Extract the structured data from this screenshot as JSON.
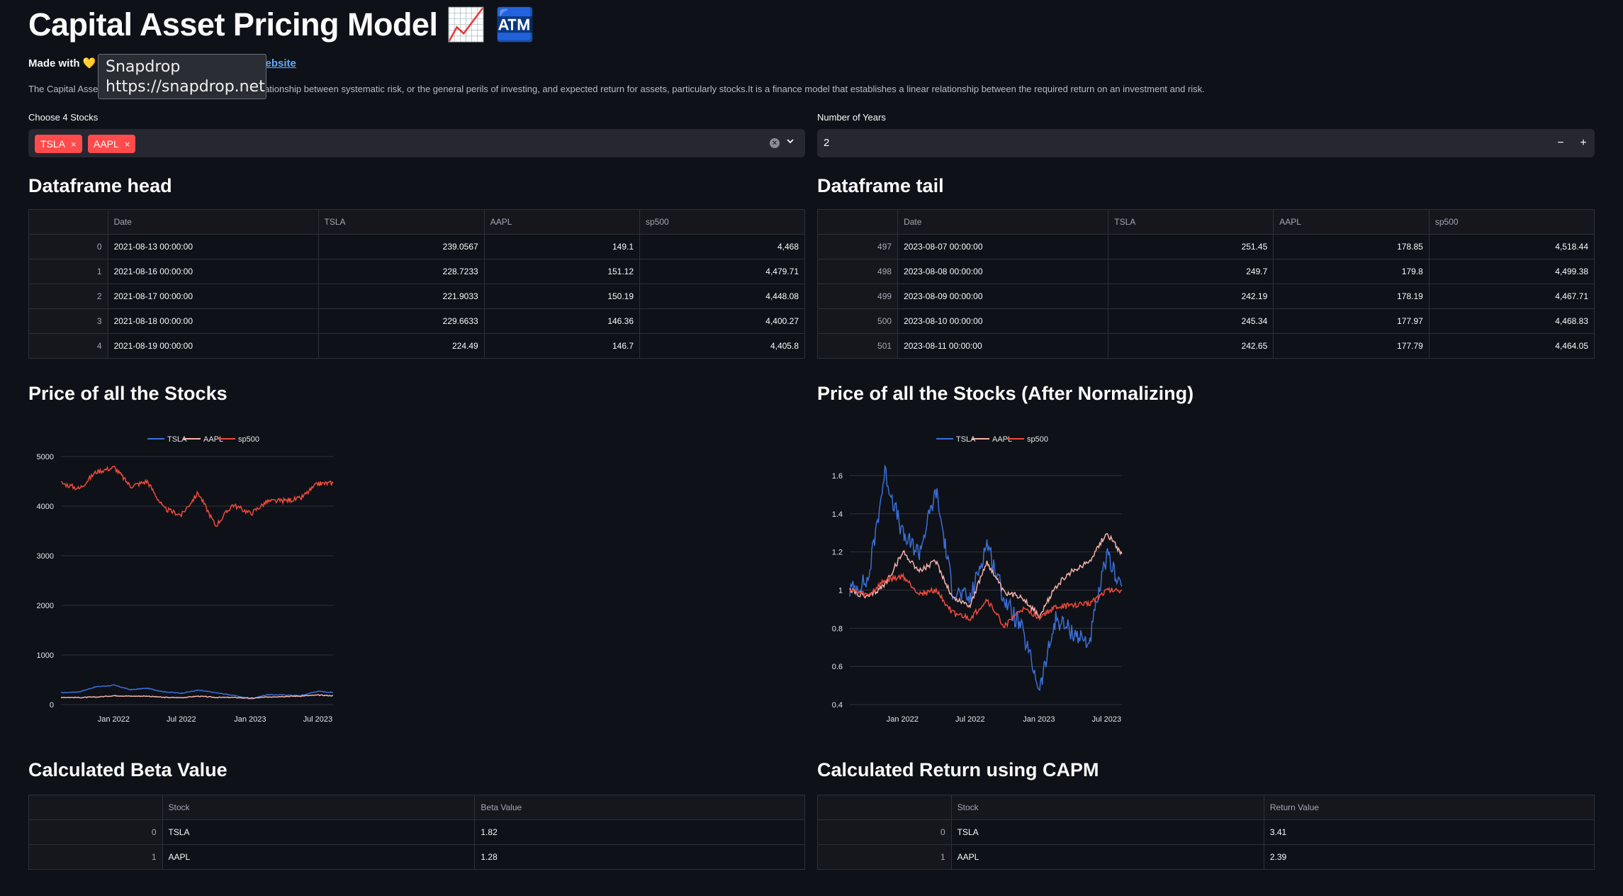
{
  "header": {
    "title": "Capital Asset Pricing Model",
    "title_emoji": "📈 🏧",
    "made_with_prefix": "Made with",
    "heart": "💛",
    "link_text": "n Portfolio website",
    "description": "The Capital Asset Pricing Model (CAPM) describes the relationship between systematic risk, or the general perils of investing, and expected return for assets, particularly stocks.It is a finance model that establishes a linear relationship between the required return on an investment and risk."
  },
  "tooltip": {
    "title": "Snapdrop",
    "url": "https://snapdrop.net"
  },
  "stock_select": {
    "label": "Choose 4 Stocks",
    "chips": [
      "TSLA",
      "AAPL"
    ],
    "chip_remove_glyph": "×",
    "clear_glyph": "×"
  },
  "years_input": {
    "label": "Number of Years",
    "value": "2",
    "minus": "−",
    "plus": "+"
  },
  "head": {
    "heading": "Dataframe head",
    "columns": [
      "",
      "Date",
      "TSLA",
      "AAPL",
      "sp500"
    ],
    "rows": [
      [
        "0",
        "2021-08-13 00:00:00",
        "239.0567",
        "149.1",
        "4,468"
      ],
      [
        "1",
        "2021-08-16 00:00:00",
        "228.7233",
        "151.12",
        "4,479.71"
      ],
      [
        "2",
        "2021-08-17 00:00:00",
        "221.9033",
        "150.19",
        "4,448.08"
      ],
      [
        "3",
        "2021-08-18 00:00:00",
        "229.6633",
        "146.36",
        "4,400.27"
      ],
      [
        "4",
        "2021-08-19 00:00:00",
        "224.49",
        "146.7",
        "4,405.8"
      ]
    ]
  },
  "tail": {
    "heading": "Dataframe tail",
    "columns": [
      "",
      "Date",
      "TSLA",
      "AAPL",
      "sp500"
    ],
    "rows": [
      [
        "497",
        "2023-08-07 00:00:00",
        "251.45",
        "178.85",
        "4,518.44"
      ],
      [
        "498",
        "2023-08-08 00:00:00",
        "249.7",
        "179.8",
        "4,499.38"
      ],
      [
        "499",
        "2023-08-09 00:00:00",
        "242.19",
        "178.19",
        "4,467.71"
      ],
      [
        "500",
        "2023-08-10 00:00:00",
        "245.34",
        "177.97",
        "4,468.83"
      ],
      [
        "501",
        "2023-08-11 00:00:00",
        "242.65",
        "177.79",
        "4,464.05"
      ]
    ]
  },
  "price_heading": "Price of all the Stocks",
  "norm_heading": "Price of all the Stocks (After Normalizing)",
  "beta": {
    "heading": "Calculated Beta Value",
    "columns": [
      "",
      "Stock",
      "Beta Value"
    ],
    "rows": [
      [
        "0",
        "TSLA",
        "1.82"
      ],
      [
        "1",
        "AAPL",
        "1.28"
      ]
    ]
  },
  "capm": {
    "heading": "Calculated Return using CAPM",
    "columns": [
      "",
      "Stock",
      "Return Value"
    ],
    "rows": [
      [
        "0",
        "TSLA",
        "3.41"
      ],
      [
        "1",
        "AAPL",
        "2.39"
      ]
    ]
  },
  "chart_data": [
    {
      "type": "line",
      "x": [
        "2021-08-13",
        "2021-10-01",
        "2021-11-15",
        "2022-01-03",
        "2022-02-15",
        "2022-04-01",
        "2022-05-15",
        "2022-07-01",
        "2022-08-15",
        "2022-10-01",
        "2022-11-15",
        "2023-01-03",
        "2023-02-15",
        "2023-04-01",
        "2023-05-15",
        "2023-07-01",
        "2023-08-11"
      ],
      "series": [
        {
          "name": "TSLA",
          "color": "#3b6fd8",
          "values": [
            239,
            258,
            360,
            390,
            300,
            330,
            260,
            230,
            290,
            240,
            190,
            115,
            200,
            195,
            180,
            270,
            243
          ]
        },
        {
          "name": "AAPL",
          "color": "#f5b3ad",
          "values": [
            149,
            142,
            152,
            180,
            170,
            172,
            145,
            140,
            170,
            145,
            145,
            128,
            152,
            165,
            172,
            192,
            178
          ]
        },
        {
          "name": "sp500",
          "color": "#ef4a3c",
          "values": [
            4468,
            4350,
            4690,
            4780,
            4400,
            4500,
            3950,
            3820,
            4270,
            3600,
            4030,
            3850,
            4090,
            4110,
            4150,
            4450,
            4464
          ]
        }
      ],
      "xticks": [
        "Jan 2022",
        "Jul 2022",
        "Jan 2023",
        "Jul 2023"
      ],
      "xtick_dates": [
        "2022-01-01",
        "2022-07-01",
        "2023-01-01",
        "2023-07-01"
      ],
      "yticks": [
        "0",
        "1000",
        "2000",
        "3000",
        "4000",
        "5000"
      ],
      "ylim": [
        0,
        5000
      ],
      "legend": "top"
    },
    {
      "type": "line",
      "x": [
        "2021-08-13",
        "2021-10-01",
        "2021-11-15",
        "2022-01-03",
        "2022-02-15",
        "2022-04-01",
        "2022-05-15",
        "2022-07-01",
        "2022-08-15",
        "2022-10-01",
        "2022-11-15",
        "2023-01-03",
        "2023-02-15",
        "2023-04-01",
        "2023-05-15",
        "2023-07-01",
        "2023-08-11"
      ],
      "series": [
        {
          "name": "TSLA",
          "color": "#3b6fd8",
          "values": [
            1.0,
            1.05,
            1.62,
            1.28,
            1.2,
            1.52,
            1.0,
            0.95,
            1.25,
            0.95,
            0.8,
            0.48,
            0.85,
            0.78,
            0.72,
            1.18,
            1.02
          ]
        },
        {
          "name": "AAPL",
          "color": "#f5b3ad",
          "values": [
            1.0,
            0.96,
            1.03,
            1.2,
            1.1,
            1.15,
            0.96,
            0.92,
            1.15,
            0.98,
            0.97,
            0.86,
            1.02,
            1.1,
            1.15,
            1.3,
            1.19
          ]
        },
        {
          "name": "sp500",
          "color": "#ef4a3c",
          "values": [
            1.0,
            0.97,
            1.05,
            1.07,
            0.98,
            1.0,
            0.88,
            0.85,
            0.95,
            0.81,
            0.9,
            0.86,
            0.91,
            0.92,
            0.93,
            1.0,
            1.0
          ]
        }
      ],
      "xticks": [
        "Jan 2022",
        "Jul 2022",
        "Jan 2023",
        "Jul 2023"
      ],
      "xtick_dates": [
        "2022-01-01",
        "2022-07-01",
        "2023-01-01",
        "2023-07-01"
      ],
      "yticks": [
        "0.4",
        "0.6",
        "0.8",
        "1",
        "1.2",
        "1.4",
        "1.6"
      ],
      "ylim": [
        0.4,
        1.7
      ],
      "legend": "top"
    }
  ]
}
